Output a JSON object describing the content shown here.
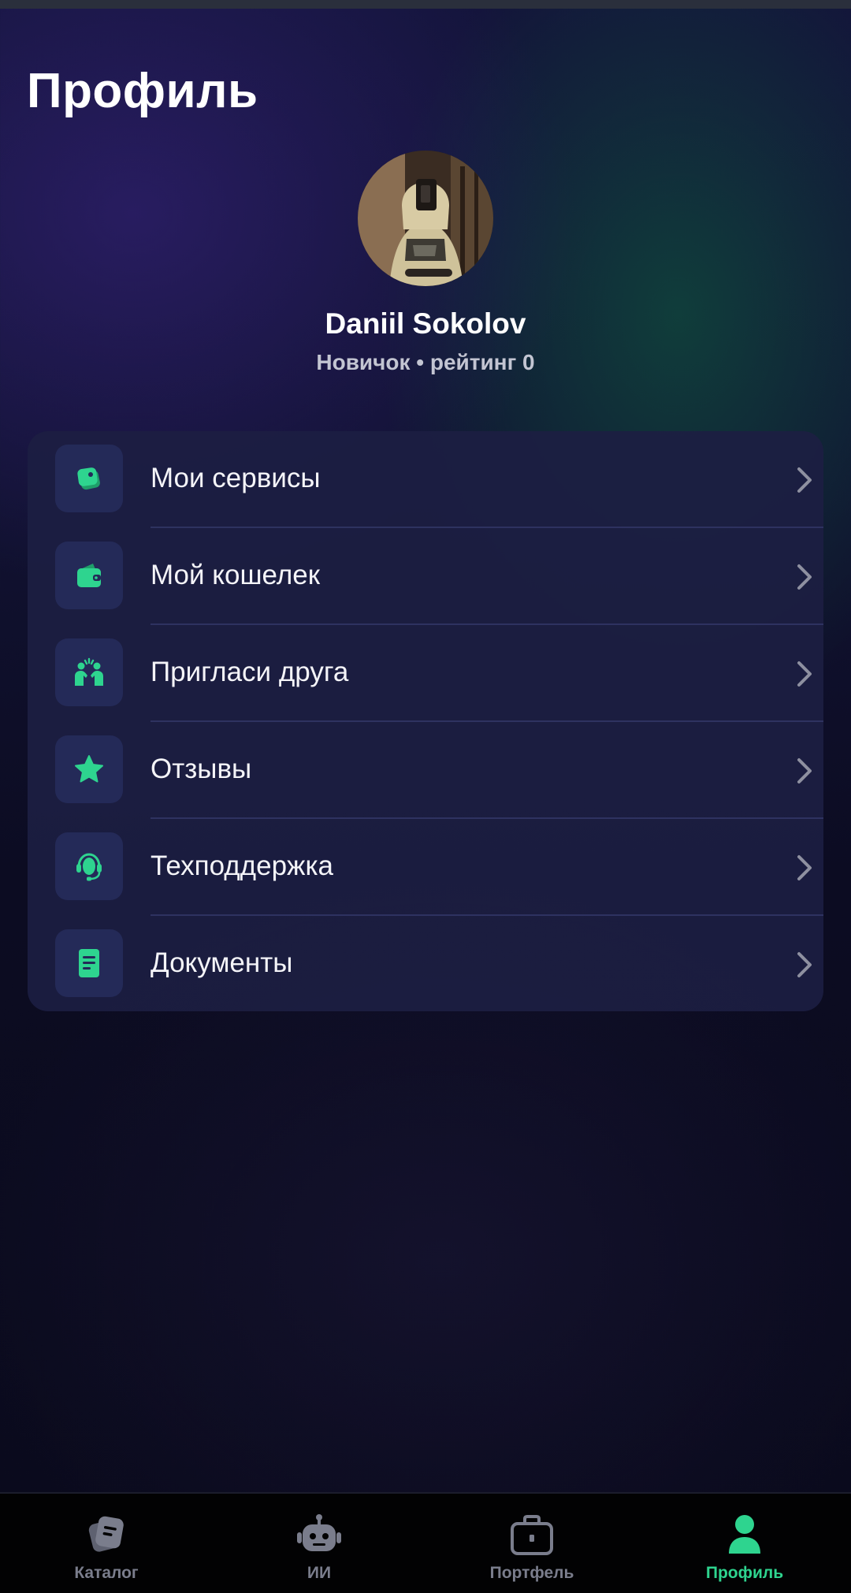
{
  "page": {
    "title": "Профиль"
  },
  "profile": {
    "name": "Daniil Sokolov",
    "status": "Новичок • рейтинг 0"
  },
  "menu": {
    "items": [
      {
        "label": "Мои сервисы",
        "icon": "services-icon"
      },
      {
        "label": "Мой кошелек",
        "icon": "wallet-icon"
      },
      {
        "label": "Пригласи друга",
        "icon": "invite-friend-icon"
      },
      {
        "label": "Отзывы",
        "icon": "star-icon"
      },
      {
        "label": "Техподдержка",
        "icon": "headset-icon"
      },
      {
        "label": "Документы",
        "icon": "document-icon"
      }
    ]
  },
  "tabbar": {
    "items": [
      {
        "label": "Каталог",
        "icon": "catalog-icon",
        "active": false
      },
      {
        "label": "ИИ",
        "icon": "robot-icon",
        "active": false
      },
      {
        "label": "Портфель",
        "icon": "briefcase-icon",
        "active": false
      },
      {
        "label": "Профиль",
        "icon": "profile-icon",
        "active": true
      }
    ]
  },
  "colors": {
    "accent": "#2ed48f",
    "card": "#1c1e42",
    "icon_box": "#242a58",
    "inactive_tab": "#7a7d8c"
  }
}
